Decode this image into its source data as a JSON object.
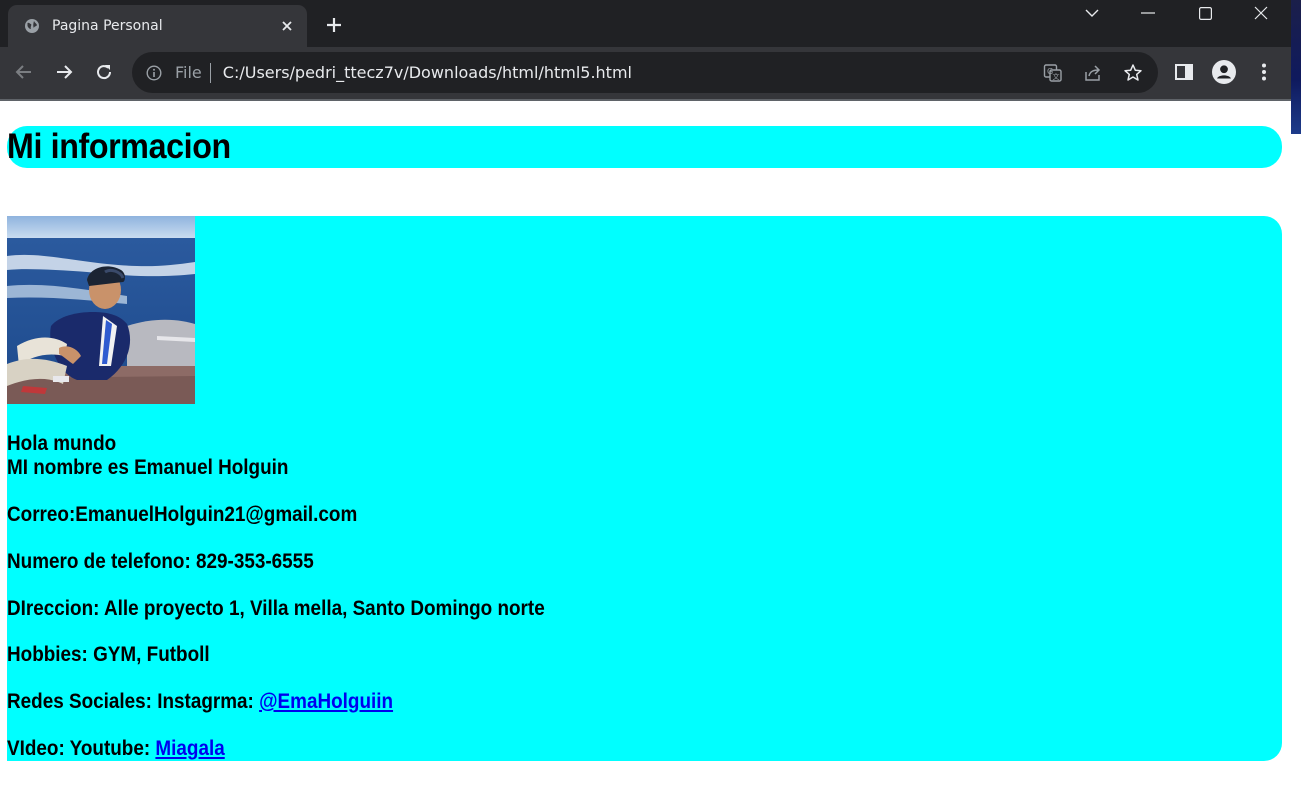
{
  "browser": {
    "tab_title": "Pagina Personal",
    "omnibox": {
      "scheme_label": "File",
      "url": "C:/Users/pedri_ttecz7v/Downloads/html/html5.html"
    },
    "colors": {
      "titlebar": "#202124",
      "toolbar": "#35363a",
      "omnibox": "#202124"
    }
  },
  "page": {
    "header_title": "Mi informacion",
    "accent_color": "#00ffff",
    "photo": {
      "alt": "Foto de perfil en un bote"
    },
    "greeting": "Hola mundo",
    "name_line": "MI nombre es Emanuel Holguin",
    "email_line": "Correo:EmanuelHolguin21@gmail.com",
    "phone_line": "Numero de telefono: 829-353-6555",
    "address_line": "DIreccion: Alle proyecto 1, Villa mella, Santo Domingo norte",
    "hobbies_line": "Hobbies: GYM, Futboll",
    "social": {
      "label": "Redes Sociales: Instagrma: ",
      "link_text": "@EmaHolguiin"
    },
    "video": {
      "label": "VIdeo: Youtube: ",
      "link_text": "Miagala"
    }
  }
}
